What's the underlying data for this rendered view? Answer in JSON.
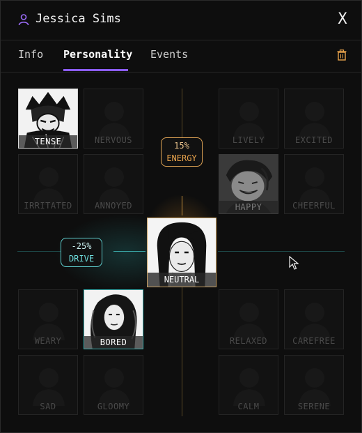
{
  "header": {
    "title": "Jessica Sims",
    "close_label": "X"
  },
  "tabs": [
    {
      "label": "Info",
      "active": false
    },
    {
      "label": "Personality",
      "active": true
    },
    {
      "label": "Events",
      "active": false
    }
  ],
  "accent": {
    "tab_underline": "#8b5cf6",
    "energy": "#e0a455",
    "drive": "#5fd0d0",
    "trash": "#e8a34c"
  },
  "energy": {
    "value": "15%",
    "label": "ENERGY"
  },
  "drive": {
    "value": "-25%",
    "label": "DRIVE"
  },
  "center_mood": {
    "label": "NEUTRAL"
  },
  "moods": {
    "tense": "TENSE",
    "nervous": "NERVOUS",
    "lively": "LIVELY",
    "excited": "EXCITED",
    "irritated": "IRRITATED",
    "annoyed": "ANNOYED",
    "happy": "HAPPY",
    "cheerful": "CHEERFUL",
    "weary": "WEARY",
    "bored": "BORED",
    "relaxed": "RELAXED",
    "carefree": "CAREFREE",
    "sad": "SAD",
    "gloomy": "GLOOMY",
    "calm": "CALM",
    "serene": "SERENE"
  }
}
